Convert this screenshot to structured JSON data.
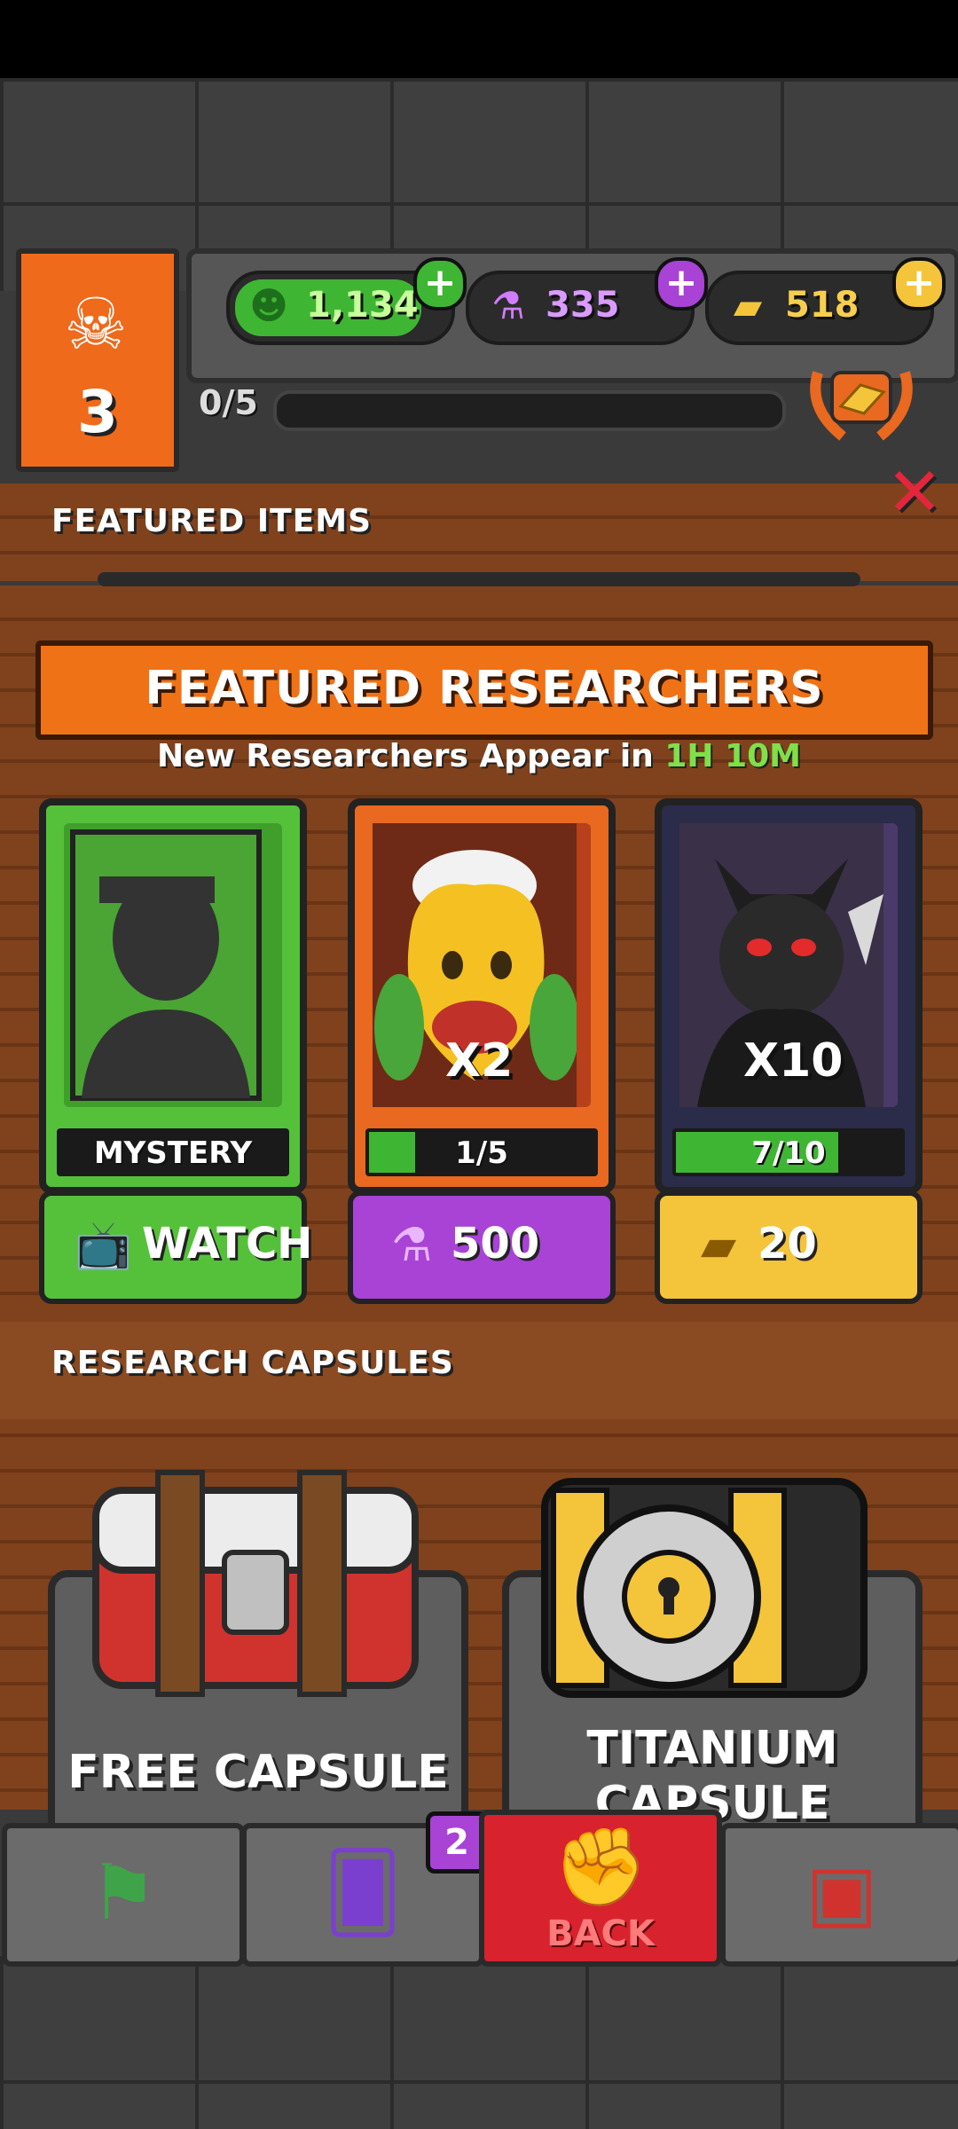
{
  "header": {
    "level": "3",
    "resources": [
      {
        "name": "zombie-currency",
        "icon": "zombie-icon",
        "value": "1,134",
        "color": "#3fb534"
      },
      {
        "name": "potion-currency",
        "icon": "potion-icon",
        "value": "335",
        "color": "#c56cff"
      },
      {
        "name": "gold-currency",
        "icon": "gold-bar-icon",
        "value": "518",
        "color": "#f4c43a"
      }
    ],
    "progress": {
      "text": "0/5",
      "value": 0
    }
  },
  "featured_items": {
    "title": "FEATURED ITEMS"
  },
  "featured_researchers": {
    "title": "FEATURED RESEARCHERS",
    "timer_prefix": "New Researchers Appear in",
    "timer_value": "1H 10M",
    "cards": [
      {
        "name": "mystery",
        "footer": "MYSTERY",
        "multiplier": "",
        "progress": null,
        "frame_color": "#55c13a",
        "button": {
          "label": "WATCH",
          "icon": "tv-icon",
          "color": "#55c13a"
        }
      },
      {
        "name": "pepper-researcher",
        "footer": "1/5",
        "multiplier": "X2",
        "progress": 0.2,
        "frame_color": "#e8691f",
        "button": {
          "label": "500",
          "icon": "potion-icon",
          "color": "#a843d6"
        }
      },
      {
        "name": "bat-researcher",
        "footer": "7/10",
        "multiplier": "X10",
        "progress": 0.7,
        "frame_color": "#2b2b4a",
        "button": {
          "label": "20",
          "icon": "gold-bar-icon",
          "color": "#f4c43a"
        }
      }
    ]
  },
  "research_capsules": {
    "title": "RESEARCH CAPSULES",
    "capsules": [
      {
        "name": "free-capsule",
        "label": "FREE CAPSULE"
      },
      {
        "name": "titanium-capsule",
        "label": "TITANIUM CAPSULE"
      }
    ]
  },
  "nav": {
    "tabs": [
      {
        "name": "missions-tab",
        "icon": "flag-icon"
      },
      {
        "name": "cards-tab",
        "icon": "cards-icon",
        "badge": "2"
      },
      {
        "name": "back-tab",
        "icon": "fist-icon",
        "label": "BACK"
      },
      {
        "name": "capsules-tab",
        "icon": "capsule-icon"
      }
    ]
  }
}
